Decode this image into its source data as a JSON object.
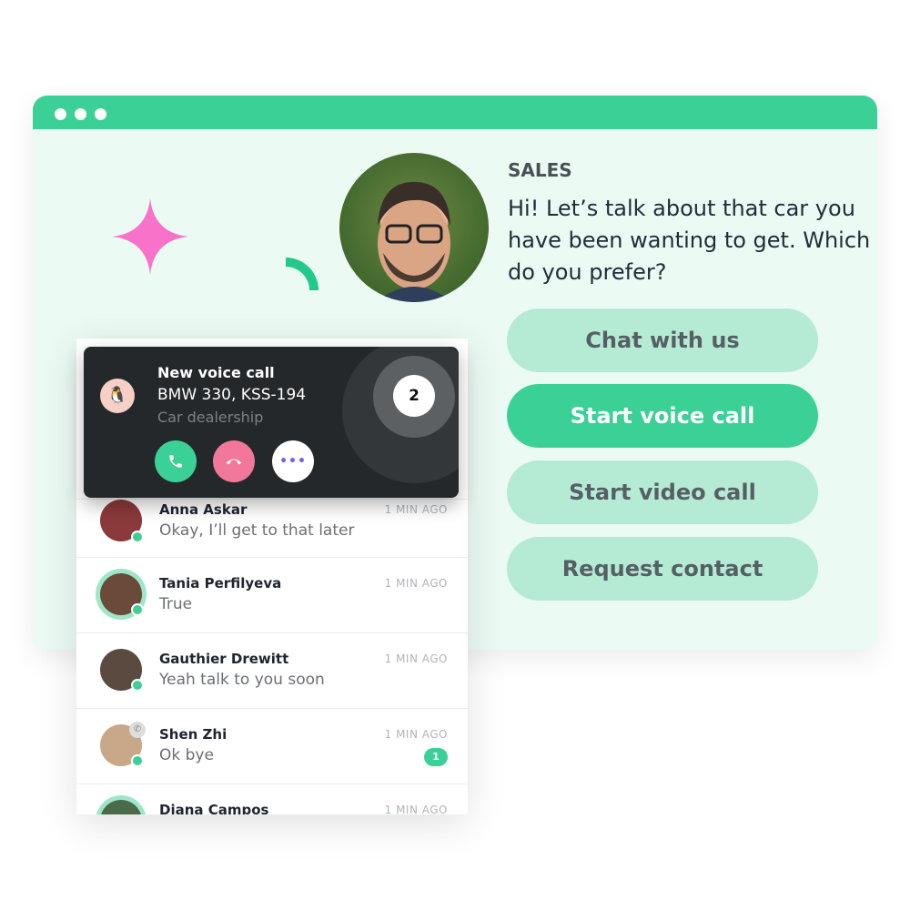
{
  "window": {
    "dots": 3,
    "header_color": "#3bd196"
  },
  "agent": {
    "department": "SALES",
    "message": "Hi! Let’s talk about that car you have been wanting to get. Which do you prefer?"
  },
  "options": [
    {
      "label": "Chat with us"
    },
    {
      "label": "Start voice call",
      "primary": true
    },
    {
      "label": "Start video call"
    },
    {
      "label": "Request contact"
    }
  ],
  "call": {
    "title": "New voice call",
    "subject": "BMW 330, KSS-194",
    "company": "Car dealership",
    "queue_count": "2",
    "accept_icon": "phone-icon",
    "decline_icon": "hang-up-icon",
    "more_icon": "more-icon"
  },
  "conversations": [
    {
      "name": "Anna Askar",
      "message": "Okay, I’ll get to that later",
      "time": "1 MIN AGO"
    },
    {
      "name": "Tania Perfilyeva",
      "message": "True",
      "time": "1 MIN AGO"
    },
    {
      "name": "Gauthier Drewitt",
      "message": "Yeah talk to you soon",
      "time": "1 MIN AGO"
    },
    {
      "name": "Shen Zhi",
      "message": "Ok bye",
      "time": "1 MIN AGO",
      "unread": "1"
    },
    {
      "name": "Diana Campos",
      "message": "",
      "time": "1 MIN AGO"
    }
  ],
  "colors": {
    "accent": "#3bd196",
    "decline": "#f2789b",
    "card": "#24282b",
    "star": "#f772c8"
  }
}
